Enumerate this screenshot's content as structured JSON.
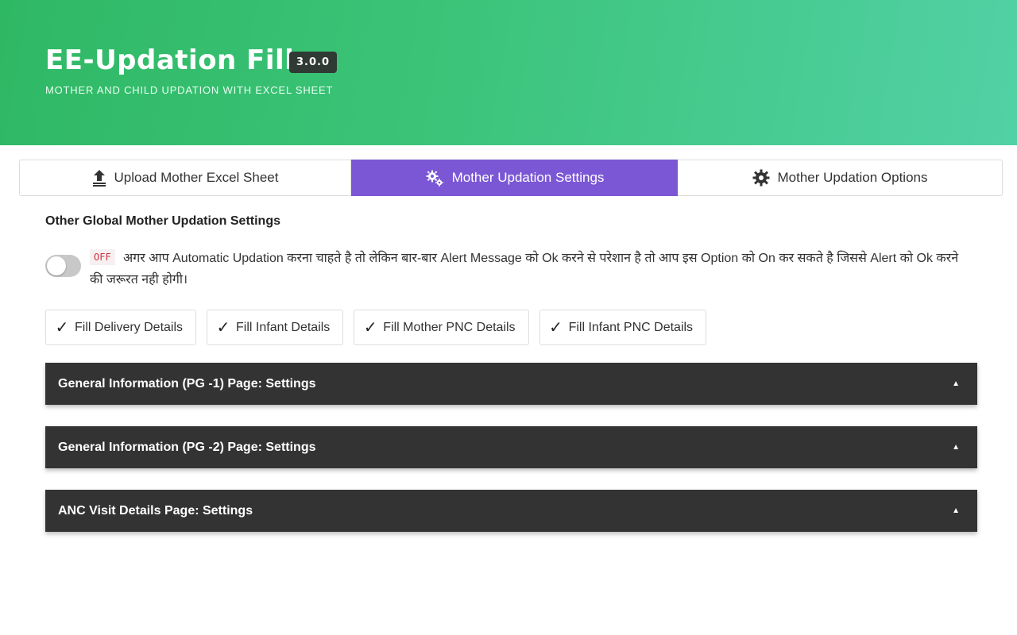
{
  "header": {
    "title": "EE-Updation Filler",
    "version": "3.0.0",
    "subtitle": "MOTHER AND CHILD UPDATION WITH EXCEL SHEET",
    "gradient_colors": [
      "#2fb864",
      "#52d1a6"
    ]
  },
  "tabs": [
    {
      "label": "Upload Mother Excel Sheet",
      "icon": "upload-icon",
      "active": false
    },
    {
      "label": "Mother Updation Settings",
      "icon": "cogs-icon",
      "active": true
    },
    {
      "label": "Mother Updation Options",
      "icon": "gear-icon",
      "active": false
    }
  ],
  "active_tab_color": "#7b57d6",
  "settings": {
    "section_title": "Other Global Mother Updation Settings",
    "toggle_state": "OFF",
    "alert_description": "अगर आप Automatic Updation करना चाहते है तो लेकिन बार-बार Alert Message को Ok करने से परेशान है तो आप इस Option को On कर सकते है जिससे Alert को Ok करने की जरूरत नही होगी।"
  },
  "chips": [
    {
      "label": "Fill Delivery Details",
      "icon": "check-icon"
    },
    {
      "label": "Fill Infant Details",
      "icon": "check-icon"
    },
    {
      "label": "Fill Mother PNC Details",
      "icon": "check-icon"
    },
    {
      "label": "Fill Infant PNC Details",
      "icon": "check-icon"
    }
  ],
  "accordions": [
    {
      "title": "General Information (PG -1) Page: Settings",
      "icon": "caret-up-icon"
    },
    {
      "title": "General Information (PG -2) Page: Settings",
      "icon": "caret-up-icon"
    },
    {
      "title": "ANC Visit Details Page: Settings",
      "icon": "caret-up-icon"
    }
  ]
}
